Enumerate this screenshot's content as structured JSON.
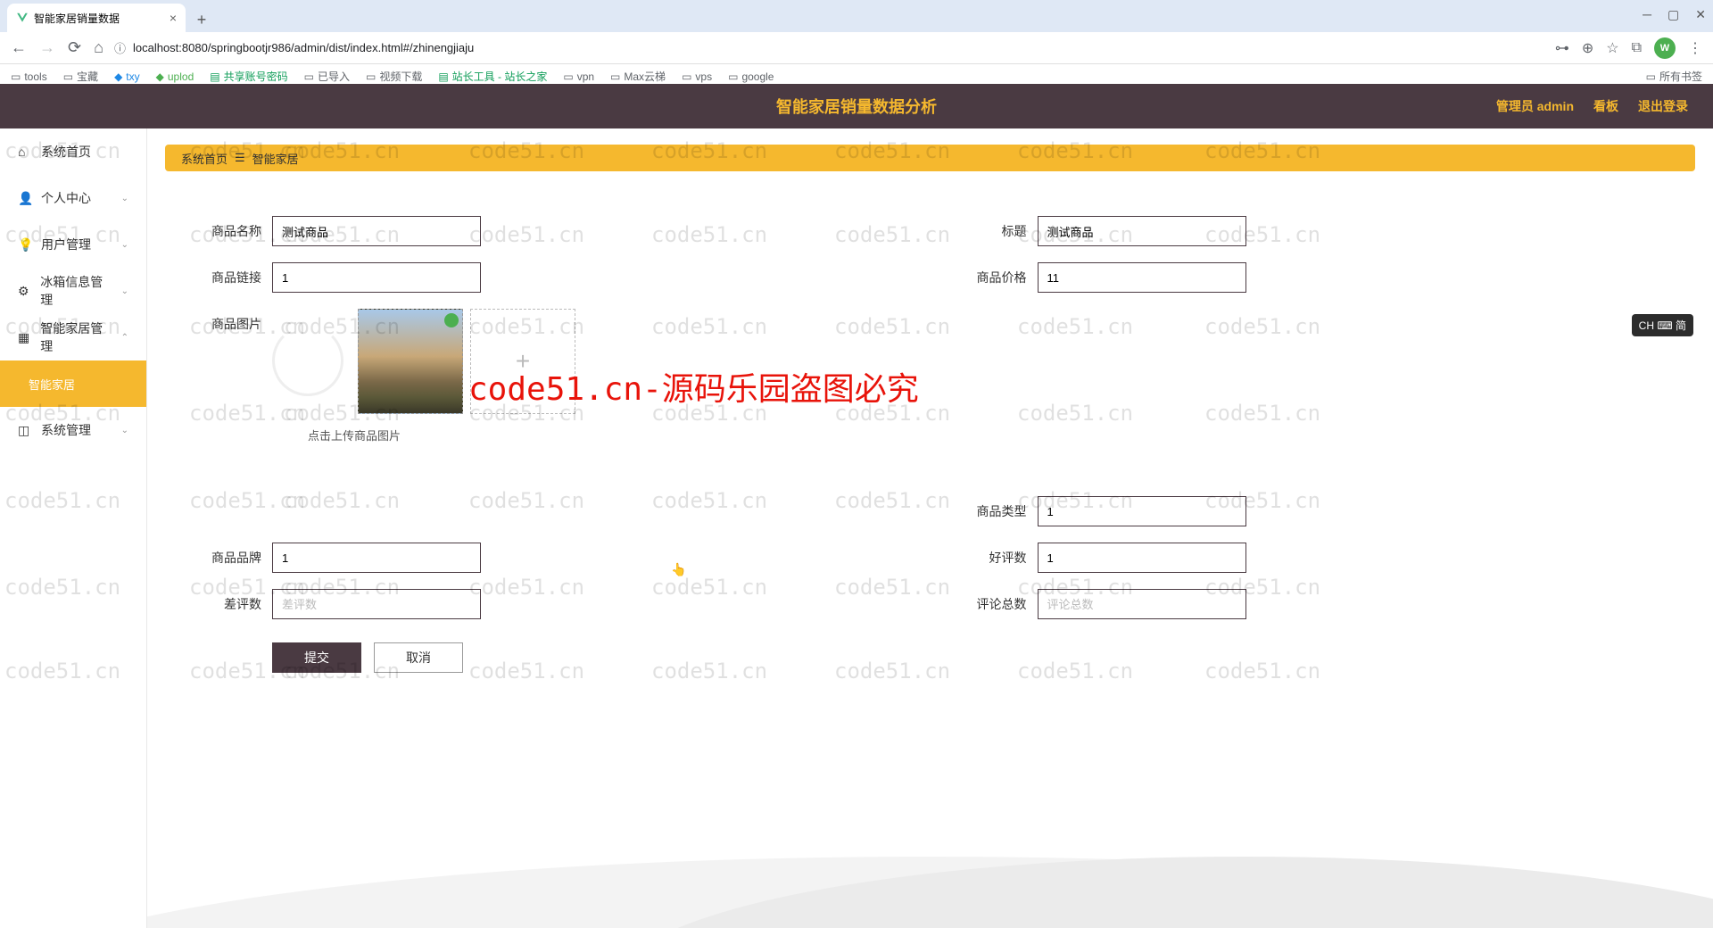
{
  "browser": {
    "tab_title": "智能家居销量数据",
    "url": "localhost:8080/springbootjr986/admin/dist/index.html#/zhinengjiaju",
    "bookmarks": [
      "tools",
      "宝藏",
      "txy",
      "uplod",
      "共享账号密码",
      "已导入",
      "视频下载",
      "站长工具 - 站长之家",
      "vpn",
      "Max云梯",
      "vps",
      "google"
    ],
    "all_bookmarks": "所有书签",
    "avatar_letter": "W"
  },
  "header": {
    "title": "智能家居销量数据分析",
    "admin_label": "管理员 admin",
    "kanban": "看板",
    "logout": "退出登录"
  },
  "sidebar": {
    "items": [
      {
        "label": "系统首页",
        "icon": "home"
      },
      {
        "label": "个人中心",
        "icon": "user"
      },
      {
        "label": "用户管理",
        "icon": "bulb"
      },
      {
        "label": "冰箱信息管理",
        "icon": "settings"
      },
      {
        "label": "智能家居管理",
        "icon": "grid"
      },
      {
        "label": "智能家居",
        "icon": "",
        "active": true
      },
      {
        "label": "系统管理",
        "icon": "dashboard"
      }
    ]
  },
  "breadcrumb": {
    "home": "系统首页",
    "current": "智能家居",
    "sep": "☰"
  },
  "form": {
    "product_name": {
      "label": "商品名称",
      "value": "测试商品"
    },
    "title": {
      "label": "标题",
      "value": "测试商品"
    },
    "product_link": {
      "label": "商品链接",
      "value": "1"
    },
    "product_price": {
      "label": "商品价格",
      "value": "11"
    },
    "product_image": {
      "label": "商品图片"
    },
    "upload_hint": "点击上传商品图片",
    "product_type": {
      "label": "商品类型",
      "value": "1"
    },
    "product_brand": {
      "label": "商品品牌",
      "value": "1"
    },
    "good_reviews": {
      "label": "好评数",
      "value": "1"
    },
    "bad_reviews": {
      "label": "差评数",
      "placeholder": "差评数",
      "value": ""
    },
    "total_reviews": {
      "label": "评论总数",
      "placeholder": "评论总数",
      "value": ""
    },
    "submit": "提交",
    "cancel": "取消"
  },
  "watermark_text": "code51.cn",
  "watermark_red": "code51.cn-源码乐园盗图必究",
  "ime_badge": "CH ⌨ 简"
}
